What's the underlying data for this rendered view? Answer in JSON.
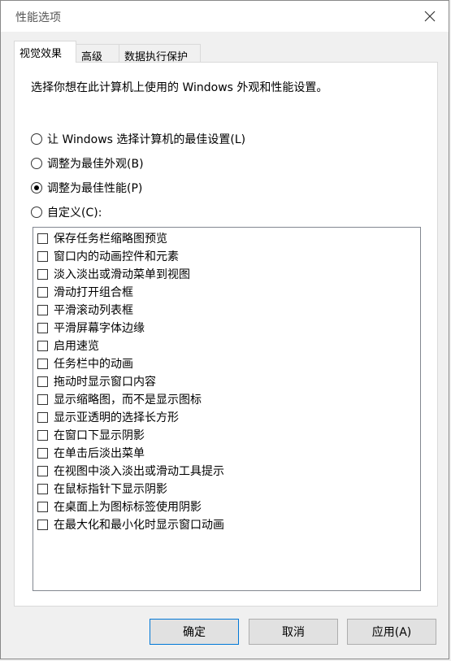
{
  "window": {
    "title": "性能选项"
  },
  "tabs": [
    {
      "label": "视觉效果"
    },
    {
      "label": "高级"
    },
    {
      "label": "数据执行保护"
    }
  ],
  "description": "选择你想在此计算机上使用的 Windows 外观和性能设置。",
  "options": [
    {
      "label": "让 Windows 选择计算机的最佳设置(L)",
      "checked": false
    },
    {
      "label": "调整为最佳外观(B)",
      "checked": false
    },
    {
      "label": "调整为最佳性能(P)",
      "checked": true
    },
    {
      "label": "自定义(C):",
      "checked": false
    }
  ],
  "effects": [
    "保存任务栏缩略图预览",
    "窗口内的动画控件和元素",
    "淡入淡出或滑动菜单到视图",
    "滑动打开组合框",
    "平滑滚动列表框",
    "平滑屏幕字体边缘",
    "启用速览",
    "任务栏中的动画",
    "拖动时显示窗口内容",
    "显示缩略图，而不是显示图标",
    "显示亚透明的选择长方形",
    "在窗口下显示阴影",
    "在单击后淡出菜单",
    "在视图中淡入淡出或滑动工具提示",
    "在鼠标指针下显示阴影",
    "在桌面上为图标标签使用阴影",
    "在最大化和最小化时显示窗口动画"
  ],
  "buttons": {
    "ok": "确定",
    "cancel": "取消",
    "apply": "应用(A)"
  }
}
